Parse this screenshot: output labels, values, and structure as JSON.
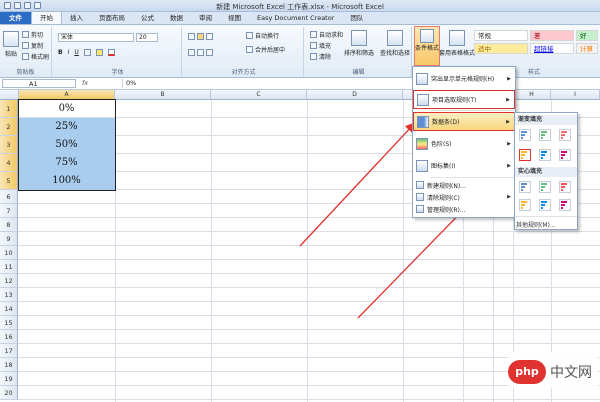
{
  "window": {
    "title": "新建 Microsoft Excel 工作表.xlsx - Microsoft Excel"
  },
  "tabs": [
    "文件",
    "开始",
    "插入",
    "页面布局",
    "公式",
    "数据",
    "审阅",
    "视图",
    "Easy Document Creator",
    "团队"
  ],
  "ribbon": {
    "clipboard": {
      "paste": "粘贴",
      "cut": "剪切",
      "copy": "复制",
      "format_painter": "格式刷",
      "label": "剪贴板"
    },
    "font": {
      "name": "宋体",
      "size": "20",
      "label": "字体"
    },
    "alignment": {
      "wrap": "自动换行",
      "merge": "合并后居中",
      "label": "对齐方式"
    },
    "editing": {
      "autosum": "自动求和",
      "fill": "填充",
      "clear": "清除",
      "sort": "排序和筛选",
      "find": "查找和选择",
      "label": "编辑"
    },
    "styles": {
      "conditional_formatting": "条件格式",
      "format_as_table": "套用表格格式",
      "cell_normal": "常规",
      "cell_bad": "差",
      "cell_good": "好",
      "cell_neutral": "适中",
      "cell_hyperlink": "超链接",
      "cell_calc": "计算",
      "label": "样式"
    }
  },
  "formula_bar": {
    "name_box": "A1",
    "fx": "fx",
    "value": "0%"
  },
  "columns": [
    "A",
    "B",
    "C",
    "D",
    "E",
    "F",
    "G",
    "H",
    "I"
  ],
  "rows": [
    "1",
    "2",
    "3",
    "4",
    "5",
    "6",
    "7",
    "8",
    "9",
    "10",
    "11",
    "12",
    "13",
    "14",
    "15",
    "16",
    "17",
    "18",
    "19",
    "20"
  ],
  "cells": [
    "0%",
    "25%",
    "50%",
    "75%",
    "100%"
  ],
  "cf_menu": {
    "highlight_rules": "突出显示单元格规则(H)",
    "top_bottom_rules": "项目选取规则(T)",
    "data_bars": "数据条(D)",
    "color_scales": "色阶(S)",
    "icon_sets": "图标集(I)",
    "new_rule": "新建规则(N)...",
    "clear_rules": "清除规则(C)",
    "manage_rules": "管理规则(R)..."
  },
  "data_bar_submenu": {
    "gradient_fill": "渐变填充",
    "solid_fill": "实心填充",
    "more_rules": "其他规则(M)..."
  },
  "watermark": {
    "logo": "php",
    "text": "中文网"
  },
  "colors": {
    "selection_fill": "#a9cdee",
    "highlight_box": "#e0322f",
    "arrow": "#e0322f"
  }
}
